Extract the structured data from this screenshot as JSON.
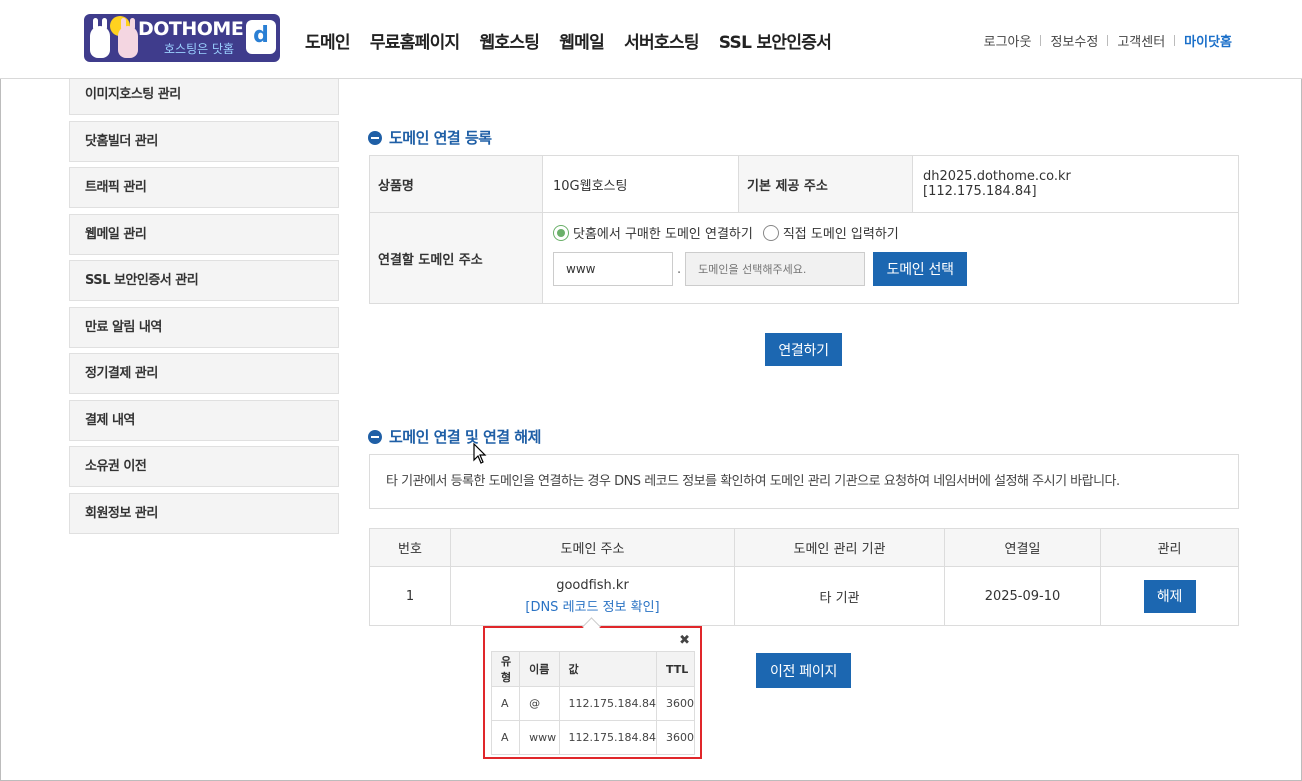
{
  "header": {
    "logo": {
      "brand": "DOTHOME",
      "slogan": "호스팅은 닷홈",
      "mark": "d"
    },
    "nav": [
      "도메인",
      "무료홈페이지",
      "웹호스팅",
      "웹메일",
      "서버호스팅",
      "SSL 보안인증서"
    ],
    "util": {
      "logout": "로그아웃",
      "edit_info": "정보수정",
      "support": "고객센터",
      "mypage": "마이닷홈"
    }
  },
  "sidebar": {
    "items": [
      "이미지호스팅 관리",
      "닷홈빌더 관리",
      "트래픽 관리",
      "웹메일 관리",
      "SSL 보안인증서 관리",
      "만료 알림 내역",
      "정기결제 관리",
      "결제 내역",
      "소유권 이전",
      "회원정보 관리"
    ]
  },
  "register": {
    "title": "도메인 연결 등록",
    "product_label": "상품명",
    "product_value": "10G웹호스팅",
    "base_addr_label": "기본 제공 주소",
    "base_addr_value": "dh2025.dothome.co.kr",
    "base_ip_value": "[112.175.184.84]",
    "connect_label": "연결할 도메인 주소",
    "radio_purchased": "닷홈에서 구매한 도메인 연결하기",
    "radio_direct": "직접 도메인 입력하기",
    "subdomain_value": "www",
    "dot": ".",
    "domain_placeholder": "도메인을 선택해주세요.",
    "select_button": "도메인 선택",
    "connect_button": "연결하기"
  },
  "connections": {
    "title": "도메인 연결 및 연결 해제",
    "notice": "타 기관에서 등록한 도메인을 연결하는 경우 DNS 레코드 정보를 확인하여 도메인 관리 기관으로 요청하여 네임서버에 설정해 주시기 바랍니다.",
    "columns": [
      "번호",
      "도메인 주소",
      "도메인 관리 기관",
      "연결일",
      "관리"
    ],
    "rows": [
      {
        "no": "1",
        "domain": "goodfish.kr",
        "dns_link": "[DNS 레코드 정보 확인]",
        "registrar": "타 기관",
        "date": "2025-09-10",
        "action": "해제"
      }
    ],
    "prev_button": "이전 페이지"
  },
  "dns_popup": {
    "close": "✖",
    "columns": [
      "유형",
      "이름",
      "값",
      "TTL"
    ],
    "records": [
      {
        "type": "A",
        "name": "@",
        "value": "112.175.184.84",
        "ttl": "3600"
      },
      {
        "type": "A",
        "name": "www",
        "value": "112.175.184.84",
        "ttl": "3600"
      }
    ]
  }
}
